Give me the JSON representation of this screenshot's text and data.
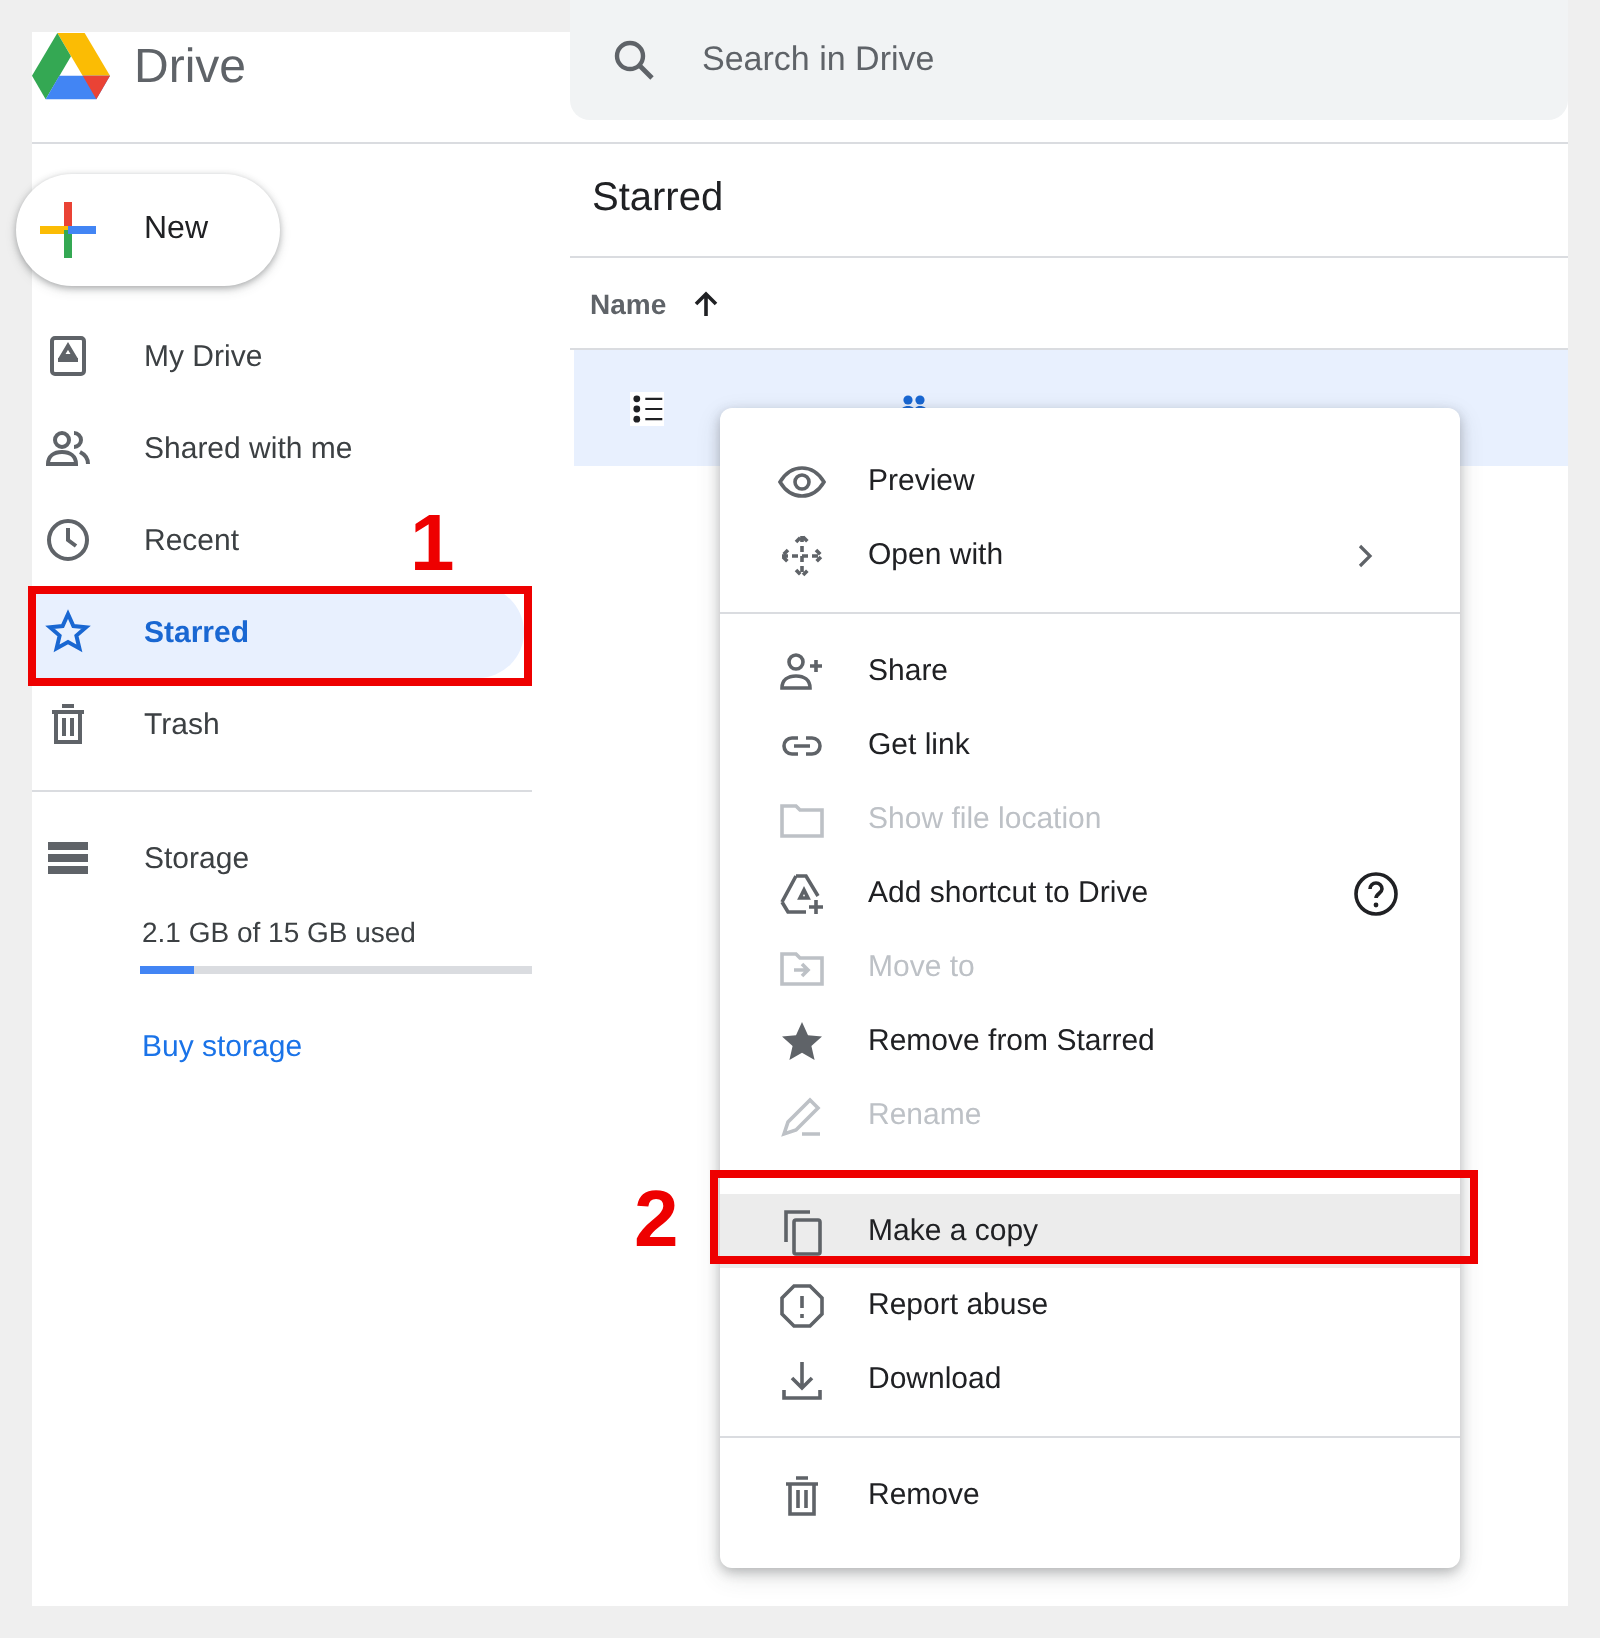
{
  "header": {
    "app_name": "Drive",
    "search": {
      "placeholder": "Search in Drive"
    }
  },
  "sidebar": {
    "new_button": "New",
    "items": [
      {
        "label": "My Drive",
        "selected": false
      },
      {
        "label": "Shared with me",
        "selected": false
      },
      {
        "label": "Recent",
        "selected": false
      },
      {
        "label": "Starred",
        "selected": true
      },
      {
        "label": "Trash",
        "selected": false
      }
    ],
    "storage": {
      "label": "Storage",
      "usage": "2.1 GB of 15 GB used",
      "level": 0.14,
      "link": "Buy storage"
    }
  },
  "main": {
    "title": "Starred",
    "columns": [
      {
        "label": "Name"
      }
    ],
    "rows": [
      {
        "shared": true,
        "selected": true
      }
    ]
  },
  "context_menu": {
    "sections": [
      [
        {
          "label": "Preview",
          "disabled": false,
          "highlighted": false,
          "submenu": false,
          "help": false
        },
        {
          "label": "Open with",
          "disabled": false,
          "highlighted": false,
          "submenu": true,
          "help": false
        }
      ],
      [
        {
          "label": "Share",
          "disabled": false,
          "highlighted": false,
          "submenu": false,
          "help": false
        },
        {
          "label": "Get link",
          "disabled": false,
          "highlighted": false,
          "submenu": false,
          "help": false
        },
        {
          "label": "Show file location",
          "disabled": true,
          "highlighted": false,
          "submenu": false,
          "help": false
        },
        {
          "label": "Add shortcut to Drive",
          "disabled": false,
          "highlighted": false,
          "submenu": false,
          "help": true
        },
        {
          "label": "Move to",
          "disabled": true,
          "highlighted": false,
          "submenu": false,
          "help": false
        },
        {
          "label": "Remove from Starred",
          "disabled": false,
          "highlighted": false,
          "submenu": false,
          "help": false
        },
        {
          "label": "Rename",
          "disabled": true,
          "highlighted": false,
          "submenu": false,
          "help": false
        }
      ],
      [
        {
          "label": "Make a copy",
          "disabled": false,
          "highlighted": true,
          "submenu": false,
          "help": false
        },
        {
          "label": "Report abuse",
          "disabled": false,
          "highlighted": false,
          "submenu": false,
          "help": false
        },
        {
          "label": "Download",
          "disabled": false,
          "highlighted": false,
          "submenu": false,
          "help": false
        }
      ],
      [
        {
          "label": "Remove",
          "disabled": false,
          "highlighted": false,
          "submenu": false,
          "help": false
        }
      ]
    ]
  },
  "annotations": [
    {
      "label": "1"
    },
    {
      "label": "2"
    }
  ]
}
